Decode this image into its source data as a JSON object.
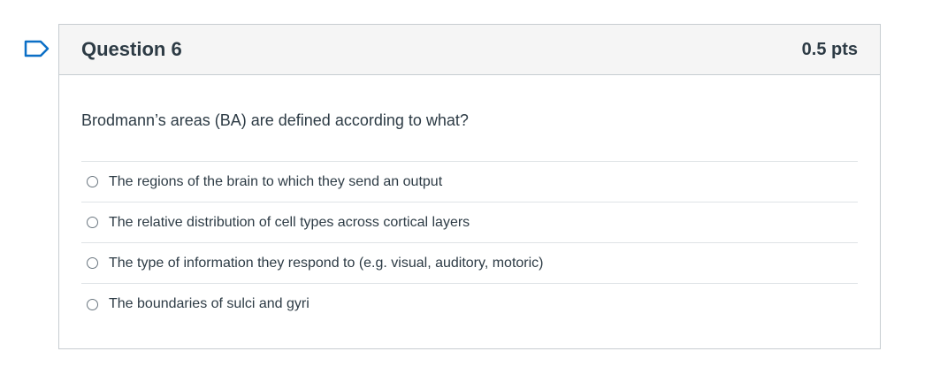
{
  "flag": {
    "icon": "bookmark-flag-icon",
    "color": "#0b6fc6"
  },
  "question": {
    "title": "Question 6",
    "points": "0.5 pts",
    "text": "Brodmann’s areas (BA) are defined according to what?",
    "answers": [
      {
        "label": "The regions of the brain to which they send an output"
      },
      {
        "label": "The relative distribution of cell types across cortical layers"
      },
      {
        "label": "The type of information they respond to (e.g. visual, auditory, motoric)"
      },
      {
        "label": "The boundaries of sulci and gyri"
      }
    ]
  }
}
